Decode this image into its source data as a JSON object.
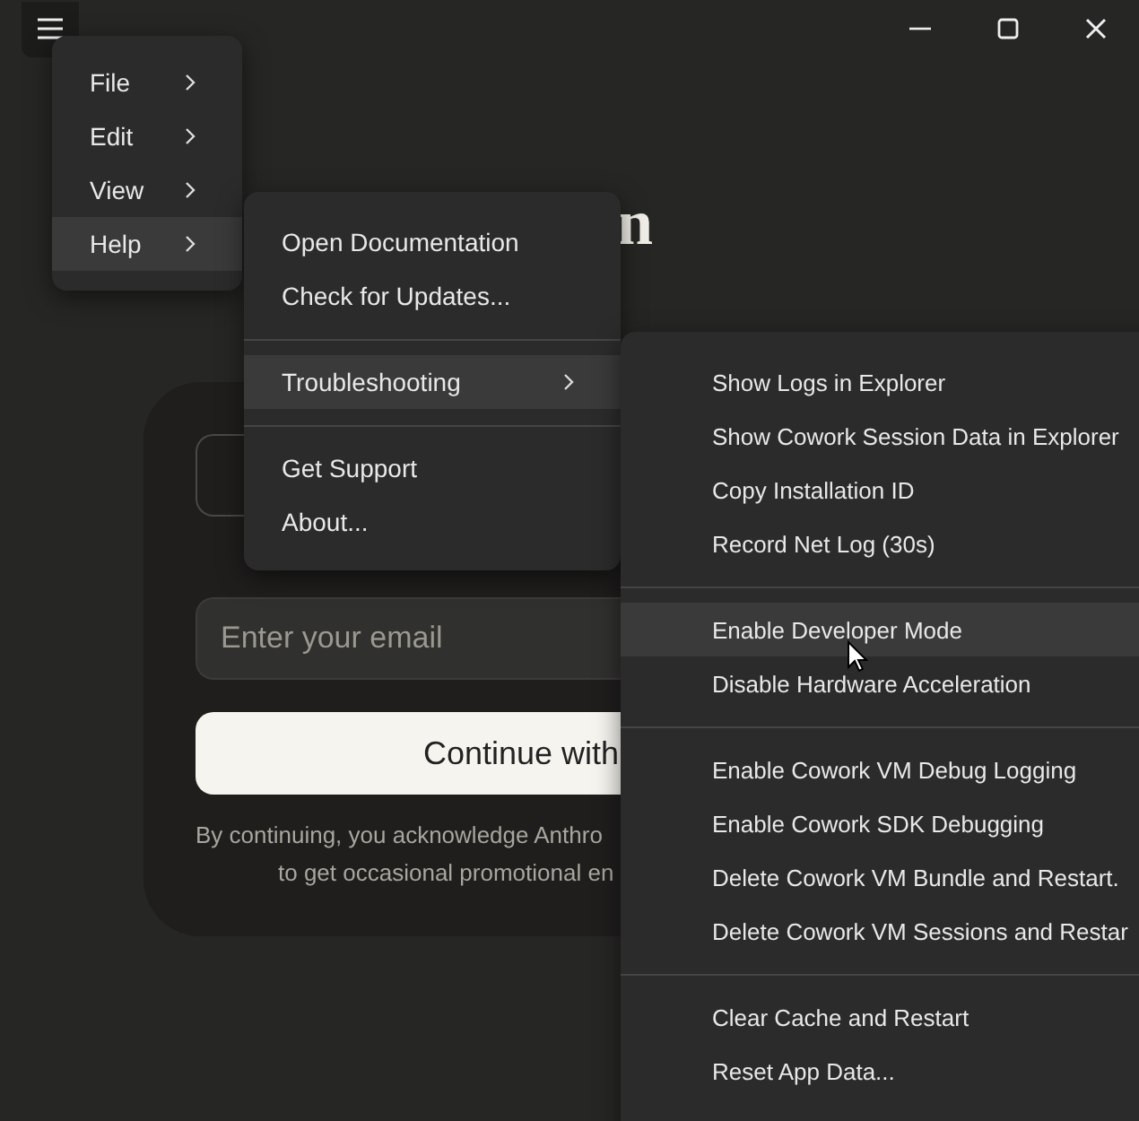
{
  "heading": "n",
  "login_card": {
    "email_field": {
      "placeholder": "Enter your email"
    },
    "continue_button": "Continue with",
    "disclaimer": [
      "By continuing, you acknowledge Anthro",
      "to get occasional promotional en"
    ]
  },
  "app_menu": {
    "items": [
      {
        "label": "File",
        "has_submenu": true,
        "selected": false
      },
      {
        "label": "Edit",
        "has_submenu": true,
        "selected": false
      },
      {
        "label": "View",
        "has_submenu": true,
        "selected": false
      },
      {
        "label": "Help",
        "has_submenu": true,
        "selected": true
      }
    ]
  },
  "help_menu": {
    "groups": [
      [
        {
          "label": "Open Documentation",
          "has_submenu": false,
          "selected": false
        },
        {
          "label": "Check for Updates...",
          "has_submenu": false,
          "selected": false
        }
      ],
      [
        {
          "label": "Troubleshooting",
          "has_submenu": true,
          "selected": true
        }
      ],
      [
        {
          "label": "Get Support",
          "has_submenu": false,
          "selected": false
        },
        {
          "label": "About...",
          "has_submenu": false,
          "selected": false
        }
      ]
    ]
  },
  "troubleshooting_menu": {
    "groups": [
      [
        {
          "label": "Show Logs in Explorer",
          "selected": false
        },
        {
          "label": "Show Cowork Session Data in Explorer",
          "selected": false
        },
        {
          "label": "Copy Installation ID",
          "selected": false
        },
        {
          "label": "Record Net Log (30s)",
          "selected": false
        }
      ],
      [
        {
          "label": "Enable Developer Mode",
          "selected": true
        },
        {
          "label": "Disable Hardware Acceleration",
          "selected": false
        }
      ],
      [
        {
          "label": "Enable Cowork VM Debug Logging",
          "selected": false
        },
        {
          "label": "Enable Cowork SDK Debugging",
          "selected": false
        },
        {
          "label": "Delete Cowork VM Bundle and Restart.",
          "selected": false
        },
        {
          "label": "Delete Cowork VM Sessions and Restar",
          "selected": false
        }
      ],
      [
        {
          "label": "Clear Cache and Restart",
          "selected": false
        },
        {
          "label": "Reset App Data...",
          "selected": false
        }
      ]
    ]
  }
}
